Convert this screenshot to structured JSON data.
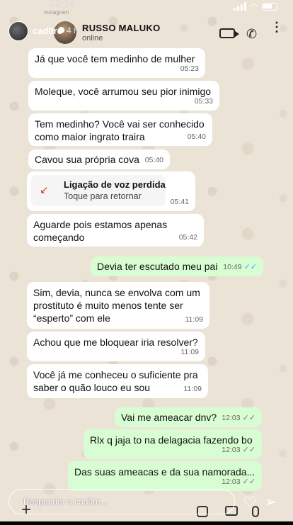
{
  "status_bar": {
    "time": "12:14",
    "source_app": "Instagram"
  },
  "story": {
    "username": "cad0re",
    "age": "4 h",
    "reply_placeholder": "Responder a cad0re..."
  },
  "chat_header": {
    "contact_name": "RUSSO MALUKO",
    "contact_status": "online"
  },
  "messages": [
    {
      "direction": "in",
      "text": "Já que você tem medinho de mulher",
      "time": "05:23"
    },
    {
      "direction": "in",
      "text": "Moleque, você arrumou seu pior inimigo",
      "time": "05:33"
    },
    {
      "direction": "in",
      "text": "Tem medinho? Você vai ser conhecido\ncomo maior ingrato traira",
      "time": "05:40"
    },
    {
      "direction": "in",
      "text": "Cavou sua própria cova",
      "time": "05:40"
    },
    {
      "direction": "in",
      "type": "missed_call",
      "title": "Ligação de voz perdida",
      "subtitle": "Toque para retornar",
      "time": "05:41"
    },
    {
      "direction": "in",
      "text": "Aguarde pois estamos apenas\ncomeçando",
      "time": "05:42"
    },
    {
      "direction": "out",
      "text": "Devia ter escutado meu pai",
      "time": "10:49",
      "read": true
    },
    {
      "direction": "in",
      "text": "Sim, devia, nunca se envolva com um\nprostituto é muito menos tente ser\n“esperto” com ele",
      "time": "11:09"
    },
    {
      "direction": "in",
      "text": "Achou que me bloquear iria resolver?",
      "time": "11:09"
    },
    {
      "direction": "in",
      "text": "Você já me conheceu o suficiente pra\nsaber o quão louco eu sou",
      "time": "11:09"
    },
    {
      "direction": "out",
      "text": "Vai me ameacar dnv?",
      "time": "12:03",
      "read": false
    },
    {
      "direction": "out",
      "text": "Rlx q jaja to na delagacia fazendo bo",
      "time": "12:03",
      "read": false
    },
    {
      "direction": "out",
      "text": "Das suas ameacas e da sua namorada...",
      "time": "12:03",
      "read": false
    }
  ],
  "colors": {
    "chat_background": "#ece3d7",
    "incoming_bubble": "#ffffff",
    "outgoing_bubble": "#d8fdd2",
    "read_ticks": "#34b7f1",
    "missed_call": "#e53935"
  },
  "icons": {
    "read_ticks": "✓✓",
    "phone": "✆",
    "missed_call": "↙",
    "menu": "⋮",
    "heart": "♡",
    "send": "➢",
    "plus": "+"
  }
}
